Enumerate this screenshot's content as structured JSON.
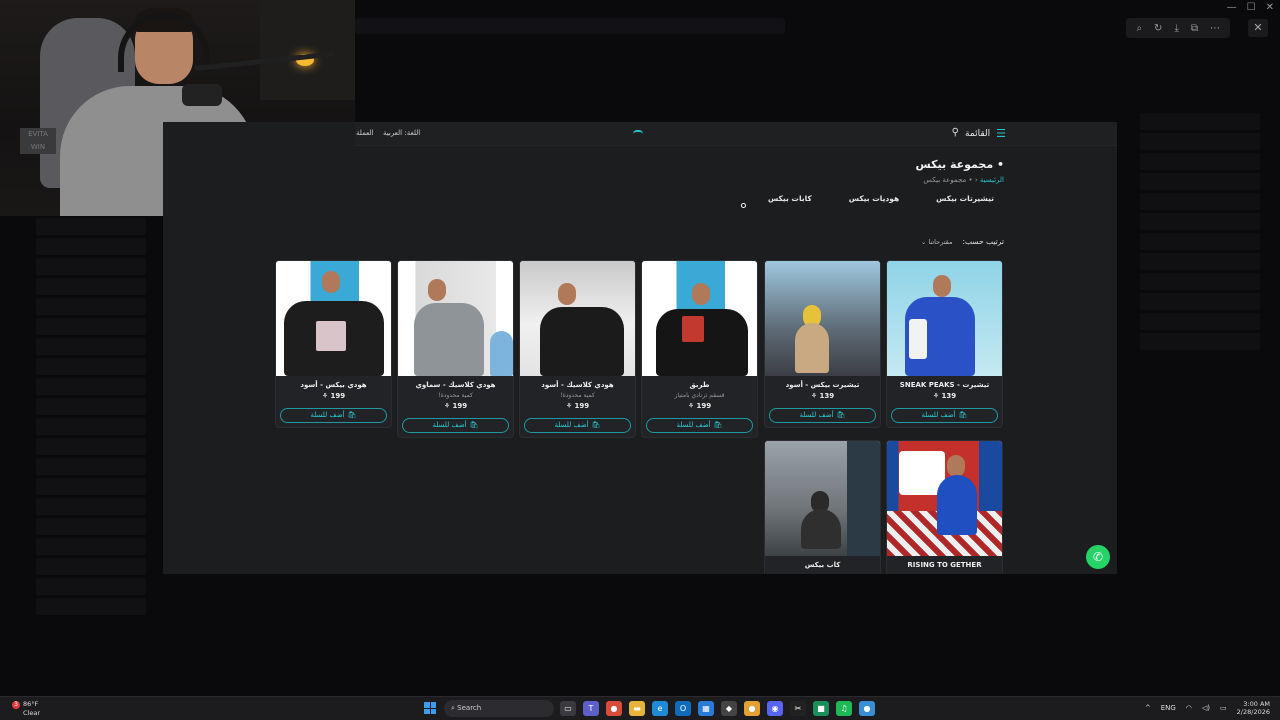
{
  "viewer": {
    "tools": [
      "⌕",
      "↻",
      "⤓",
      "⧉",
      "⋯"
    ],
    "close": "✕",
    "window_controls": [
      "—",
      "☐",
      "✕"
    ]
  },
  "webcam": {
    "sign_text": "EVITA\nWIN"
  },
  "site": {
    "menu_label": "القائمة",
    "language_label": "اللغة: العربية",
    "currency_label": "العملة",
    "page_title": "• مجموعة بيكس",
    "breadcrumb_home": "الرئيسية",
    "breadcrumb_separator": "‹",
    "breadcrumb_current": "• مجموعة بيكس",
    "categories": [
      "تيشيرتات بيكس",
      "هوديات بيكس",
      "كابات بيكس"
    ],
    "sort_label": "ترتيب حسب:",
    "sort_value": "مقترحاتنا",
    "accent_color": "#29c2c9"
  },
  "products": [
    {
      "name": "تيشيرت - SNEAK PEAKS",
      "note": "",
      "price": "139",
      "button": "أضف للسلة"
    },
    {
      "name": "تيشيرت بيكس - أسود",
      "note": "",
      "price": "139",
      "button": "أضف للسلة"
    },
    {
      "name": "طربق",
      "note": "قسقم ثرنادي بامتياز",
      "price": "199",
      "button": "أضف للسلة"
    },
    {
      "name": "هودي كلاسيك - أسود",
      "note": "كمية محدودة!",
      "price": "199",
      "button": "أضف للسلة"
    },
    {
      "name": "هودي كلاسيك - سماوي",
      "note": "كمية محدودة!",
      "price": "199",
      "button": "أضف للسلة"
    },
    {
      "name": "هودي بيكس - أسود",
      "note": "",
      "price": "199",
      "button": "أضف للسلة"
    },
    {
      "name": "RISING TO GETHER",
      "note": "",
      "price": "",
      "button": ""
    },
    {
      "name": "كاب بيكس",
      "note": "",
      "price": "",
      "button": ""
    }
  ],
  "taskbar": {
    "weather_temp": "86°F",
    "weather_desc": "Clear",
    "search_placeholder": "Search",
    "lang": "ENG",
    "time": "3:00 AM",
    "date": "2/28/2026"
  }
}
